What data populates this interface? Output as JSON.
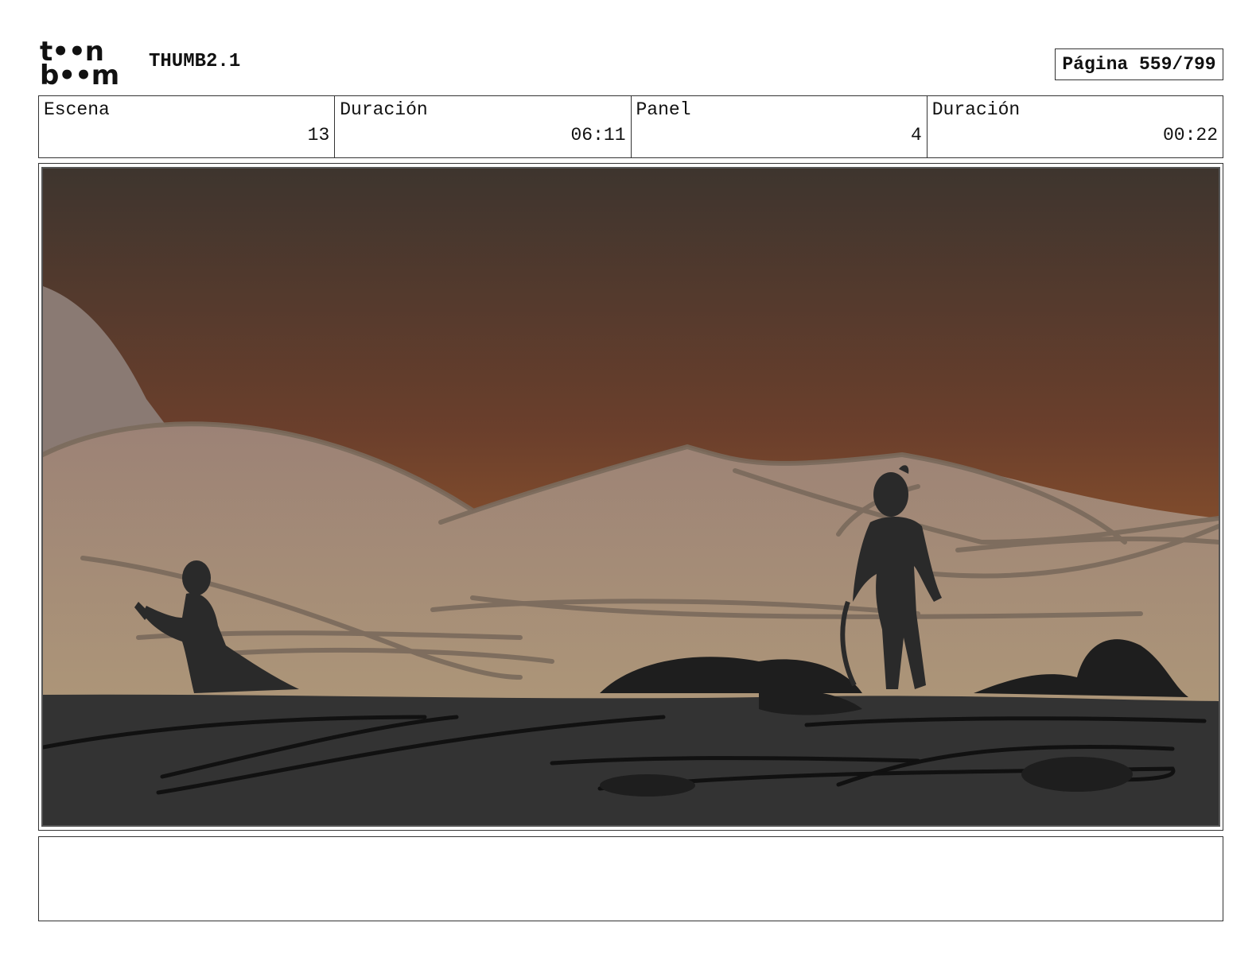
{
  "header": {
    "logo_line1": "t••n",
    "logo_line2": "b••m",
    "title": "THUMB2.1",
    "page_label": "Página 559/799"
  },
  "info": [
    {
      "label": "Escena",
      "value": "13"
    },
    {
      "label": "Duración",
      "value": "06:11"
    },
    {
      "label": "Panel",
      "value": "4"
    },
    {
      "label": "Duración",
      "value": "00:22"
    }
  ],
  "panel": {
    "colors": {
      "sky_top": "#3e352e",
      "sky_mid": "#6b3f2c",
      "sky_bottom": "#b0682c",
      "dunes": "#a89078",
      "ground": "#333333",
      "silhouette": "#2a2a2a",
      "sketch_lines": "#7a6a5c"
    }
  },
  "notes": {
    "text": ""
  }
}
